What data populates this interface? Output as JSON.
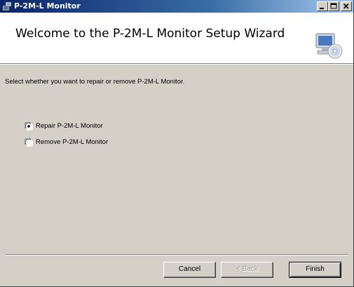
{
  "window": {
    "title": "P-2M-L Monitor",
    "minimize_icon": "minimize-icon",
    "maximize_icon": "maximize-icon",
    "close_icon": "close-icon"
  },
  "banner": {
    "title": "Welcome to the P-2M-L Monitor Setup Wizard",
    "icon": "computer-cd-icon"
  },
  "main": {
    "instruction": "Select whether you want to repair or remove P-2M-L Monitor.",
    "options": [
      {
        "label": "Repair P-2M-L Monitor",
        "selected": true
      },
      {
        "label": "Remove P-2M-L Monitor",
        "selected": false
      }
    ]
  },
  "footer": {
    "cancel_label": "Cancel",
    "back_label": "< Back",
    "finish_label": "Finish"
  },
  "colors": {
    "titlebar_start": "#0a246a",
    "titlebar_end": "#a6caf0",
    "dialog_bg": "#d4d0c8",
    "banner_bg": "#ffffff"
  }
}
